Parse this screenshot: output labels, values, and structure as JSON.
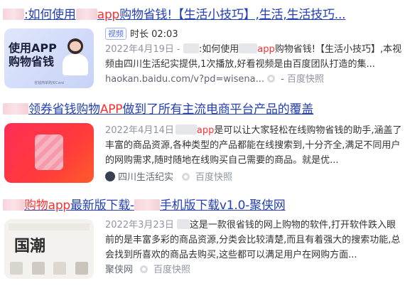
{
  "results": [
    {
      "title_pre": ":如何使用",
      "title_red": "app",
      "title_post": "购物省钱!【生活小技巧】,生活,生活技巧...",
      "thumb_text": "使用APP\n购物省钱",
      "thumb_caption": "省钱简单购买Card ",
      "badge": "视频",
      "duration_label": "时长 02:03",
      "date": "2022年4月19日",
      "snippet_pre": " - ",
      "snippet_a": ":如何使用",
      "snippet_red": "app",
      "snippet_b": "购物省钱!【生活小技巧】,本视频由四川生活纪实提供,1次播放,好看视频是由百度团队打造的集...",
      "url": "haokan.baidu.com/v?pd=wisena...",
      "source_sep": " - ",
      "cache": "百度快照"
    },
    {
      "title_a": "领券省钱购物",
      "title_red": "APP",
      "title_b": "做到了所有主流电商平台产品的覆盖",
      "date": "2022年4月14日",
      "snippet_red": "app",
      "snippet_b": "是可以让大家轻松在线购物省钱的助手,涵盖了丰富的商品资源,各种类型的产品都能在线搜索到,十分齐全,满足不同用户的网购需求,随时随地在线购买自己需要的商品。就是优...",
      "source": "四川生活纪实",
      "cache": "百度快照"
    },
    {
      "title_red": "购物app",
      "title_a": "最新版下载-",
      "title_b": "手机版下载v1.0-聚侠网",
      "thumb_text": "国潮",
      "date": "2022年3月23日",
      "snippet": "这是一款很省钱的网上购物的软件,打开软件跌入眼前的是丰富多彩的商品资源,分类会比较清楚,而且有着强大的搜索功能,总会找到所喜欢的商品去购买,这些都可以满足用户在网购方面...",
      "source": "聚侠网",
      "cache": "百度快照"
    }
  ],
  "colors": {
    "link": "#2440b3",
    "highlight": "#f73131",
    "meta": "#9195a3"
  }
}
